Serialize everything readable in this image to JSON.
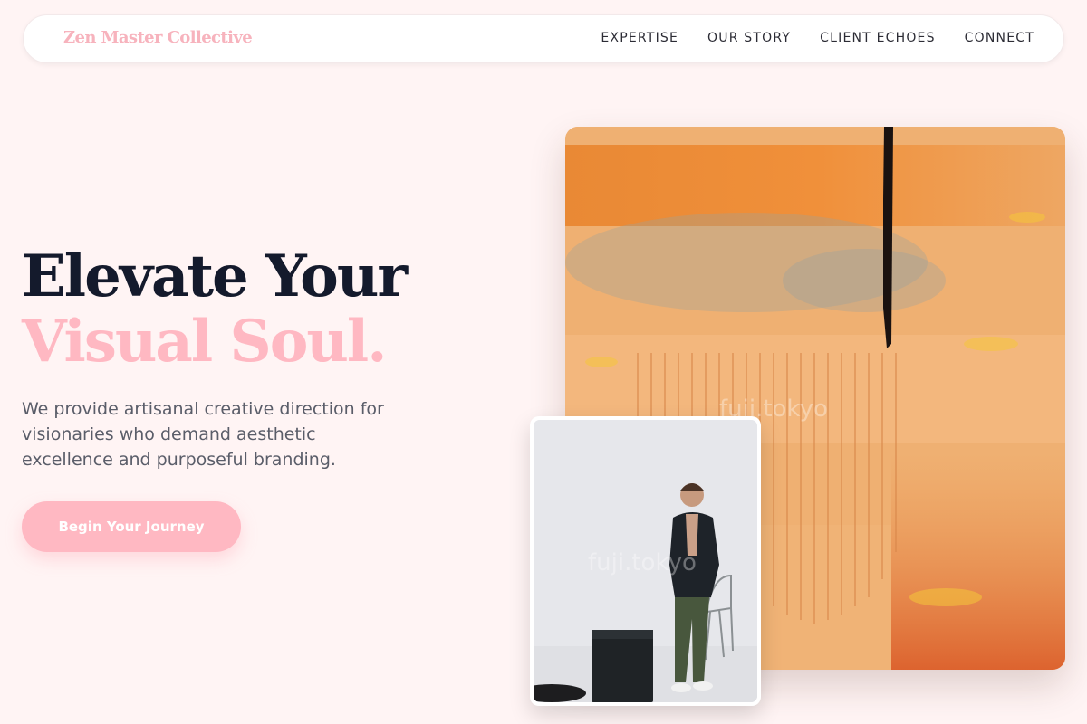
{
  "brand": {
    "name": "Zen Master Collective"
  },
  "nav": {
    "links": [
      {
        "label": "EXPERTISE"
      },
      {
        "label": "OUR STORY"
      },
      {
        "label": "CLIENT ECHOES"
      },
      {
        "label": "CONNECT"
      }
    ]
  },
  "hero": {
    "headline_line1": "Elevate Your",
    "headline_line2": "Visual Soul.",
    "description": "We provide artisanal creative direction for visionaries who demand aesthetic excellence and purposeful branding.",
    "cta_label": "Begin Your Journey"
  },
  "images": {
    "art_watermark": "fuji.tokyo",
    "photo_watermark": "fuji.tokyo"
  },
  "colors": {
    "background": "#fff4f4",
    "accent_pink": "#ffb8c2",
    "headline_dark": "#141a2c",
    "body_text": "#5a5d69"
  }
}
